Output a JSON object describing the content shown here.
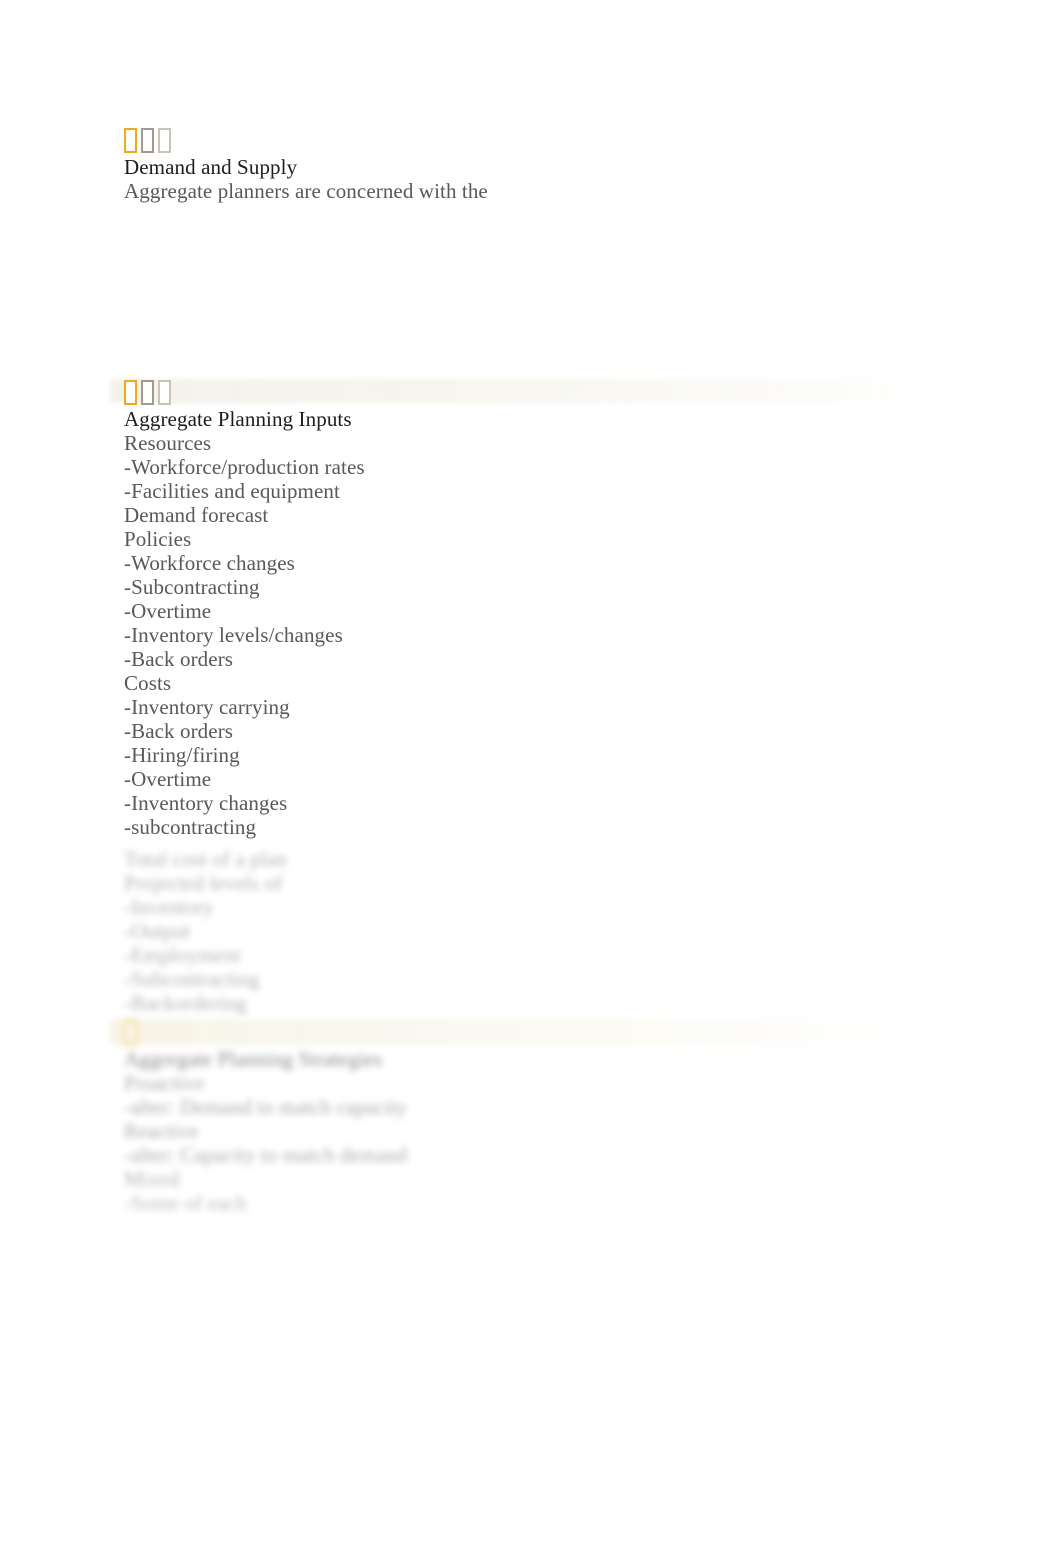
{
  "document": {
    "background_color": "#ffffff",
    "text_color_heading": "#1d1d1d",
    "text_color_body": "#585858",
    "glyph_colors": {
      "first": "#f0a81e",
      "second": "#a39a8e",
      "third": "#c9c3b8"
    }
  },
  "sections": [
    {
      "marker_icons": [
        "missing-glyph-box",
        "missing-glyph-box",
        "missing-glyph-box"
      ],
      "title": "Demand and Supply",
      "lines": [
        "Aggregate planners are concerned with the"
      ]
    },
    {
      "marker_icons": [
        "missing-glyph-box",
        "missing-glyph-box",
        "missing-glyph-box"
      ],
      "title": "Aggregate Planning Inputs",
      "lines": [
        "Resources",
        "-Workforce/production rates",
        "-Facilities and equipment",
        "Demand forecast",
        "Policies",
        "-Workforce changes",
        "-Subcontracting",
        "-Overtime",
        "-Inventory levels/changes",
        "-Back orders",
        "Costs",
        "-Inventory carrying",
        "-Back orders",
        "-Hiring/firing",
        "-Overtime",
        "-Inventory changes",
        "-subcontracting"
      ],
      "faded_lines": [
        "Total cost of a plan",
        "Projected levels of",
        "-Inventory",
        "-Output",
        "-Employment",
        "-Subcontracting",
        "-Backordering"
      ]
    },
    {
      "marker_icons": [
        "missing-glyph-box"
      ],
      "title": "Aggregate Planning Strategies",
      "faded_lines": [
        "Proactive",
        "-alter: Demand to match capacity",
        "Reactive",
        "-alter: Capacity to match demand",
        "Mixed",
        "-Some of each"
      ]
    }
  ]
}
